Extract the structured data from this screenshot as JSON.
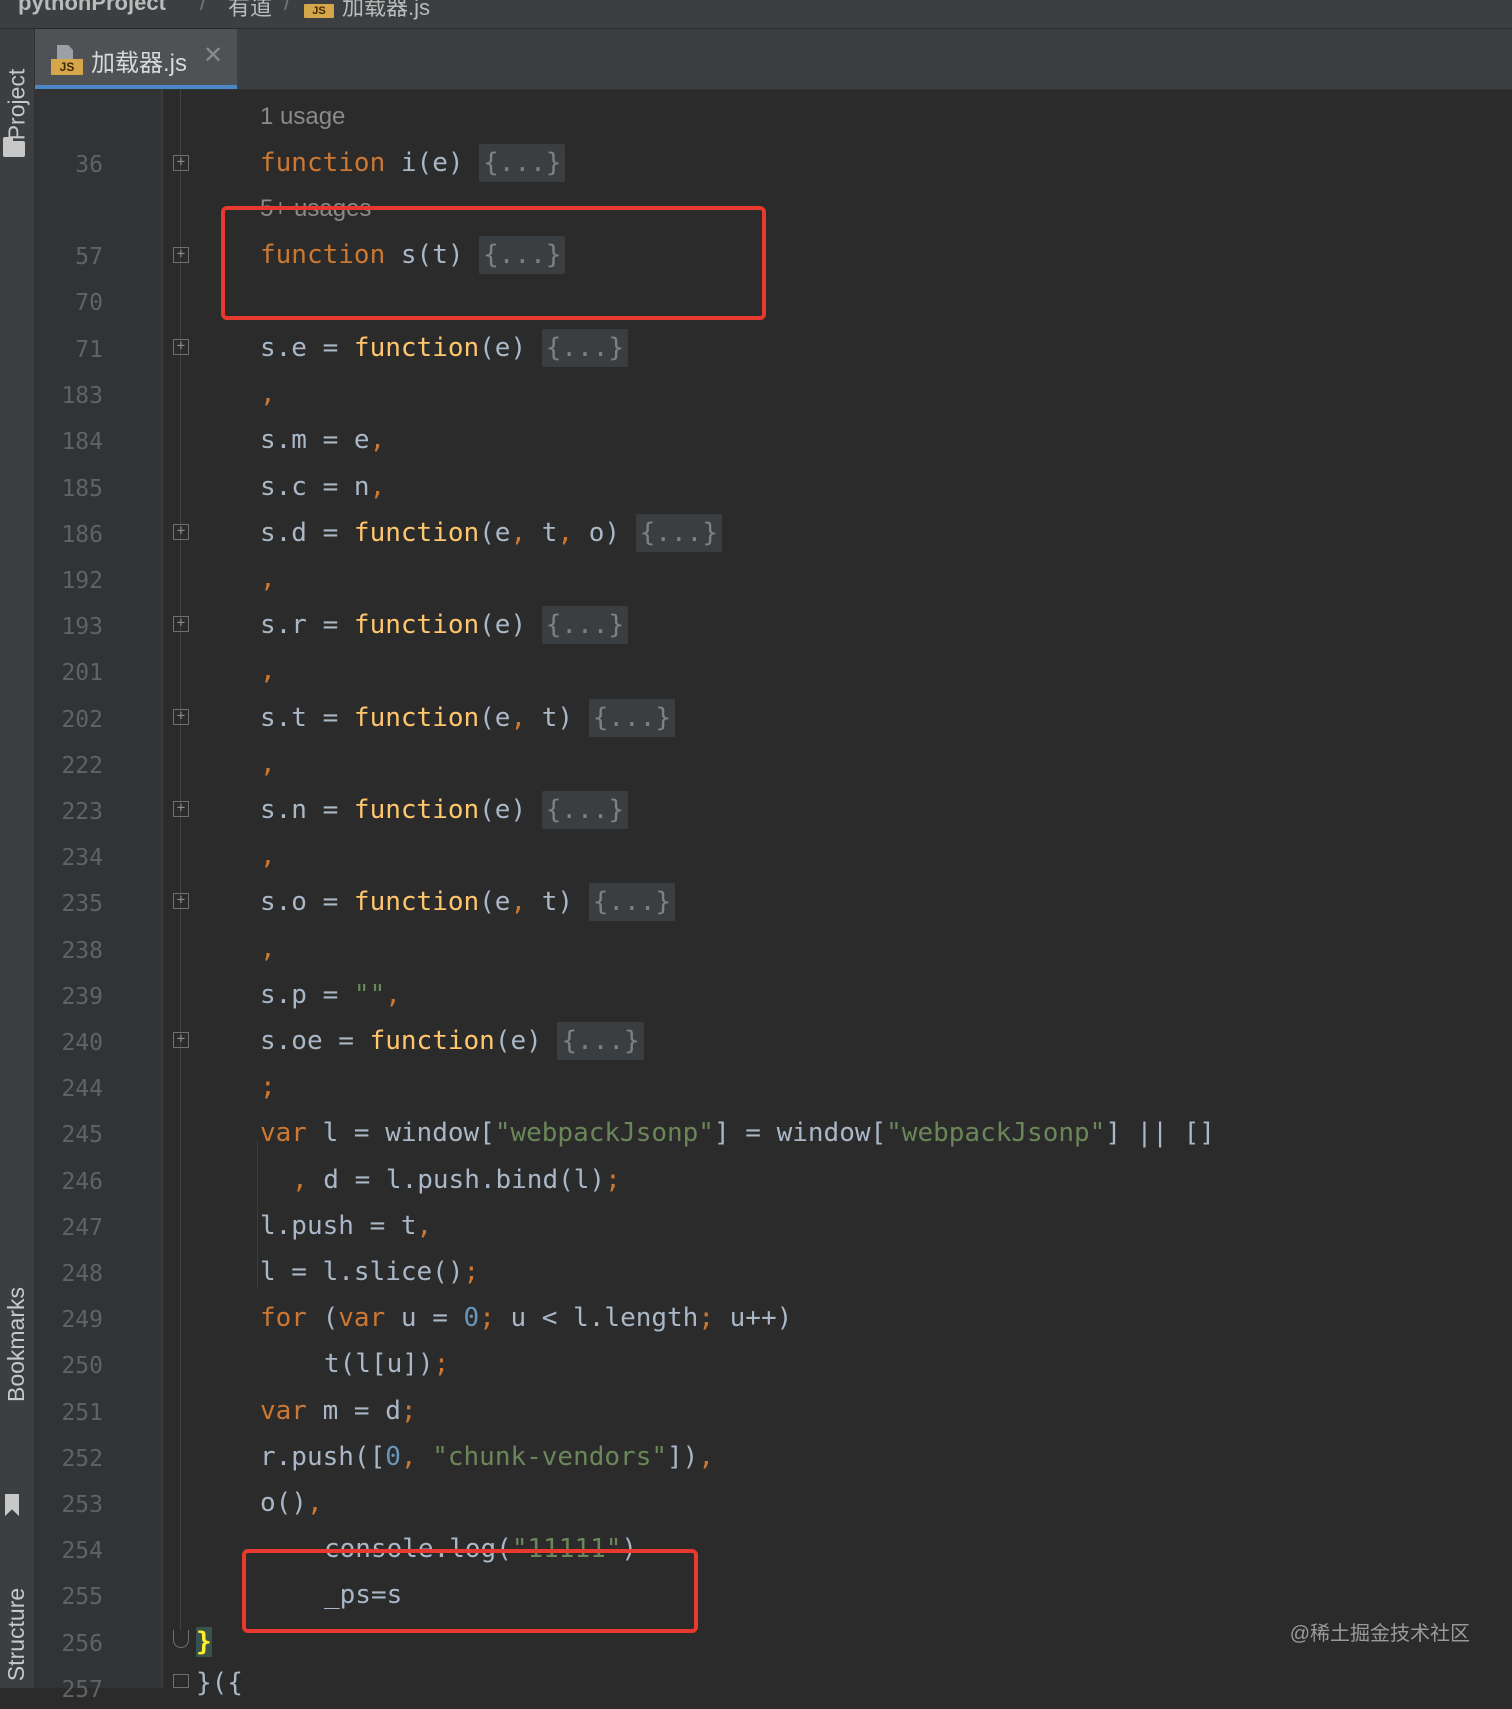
{
  "breadcrumb": {
    "project": "pythonProject",
    "separator": "/",
    "folder": "有道",
    "file_badge": "JS",
    "file": "加载器.js"
  },
  "toolstrip": {
    "project_label": "Project",
    "bookmarks_label": "Bookmarks",
    "structure_label": "Structure"
  },
  "tab": {
    "badge": "JS",
    "label": "加载器.js",
    "close": "✕"
  },
  "editor": {
    "usage_hint_1": "1 usage",
    "usage_hint_2": "5+ usages",
    "line_numbers": [
      "36",
      "57",
      "70",
      "71",
      "183",
      "184",
      "185",
      "186",
      "192",
      "193",
      "201",
      "202",
      "222",
      "223",
      "234",
      "235",
      "238",
      "239",
      "240",
      "244",
      "245",
      "246",
      "247",
      "248",
      "249",
      "250",
      "251",
      "252",
      "253",
      "254",
      "255",
      "256",
      "257"
    ],
    "folded_placeholder": "{...}",
    "lines": {
      "l36_kw": "function",
      "l36_name": " i(e) ",
      "l57_kw": "function",
      "l57_name": " s(t) ",
      "l71_pre": "s.e = ",
      "l71_kw": "function",
      "l71_args": "(e) ",
      "comma": ",",
      "l184_pre": "s.m = e",
      "l185_pre": "s.c = n",
      "l186_pre": "s.d = ",
      "l186_kw": "function",
      "l186_a1": "(e",
      "l186_a2": " t",
      "l186_a3": " o) ",
      "l193_pre": "s.r = ",
      "l193_kw": "function",
      "l193_args": "(e) ",
      "l202_pre": "s.t = ",
      "l202_kw": "function",
      "l202_a1": "(e",
      "l202_a2": " t) ",
      "l223_pre": "s.n = ",
      "l223_kw": "function",
      "l223_args": "(e) ",
      "l235_pre": "s.o = ",
      "l235_kw": "function",
      "l235_a1": "(e",
      "l235_a2": " t) ",
      "l239_pre": "s.p = ",
      "l239_str": "\"\"",
      "l240_pre": "s.oe = ",
      "l240_kw": "function",
      "l240_args": "(e) ",
      "semicolon": ";",
      "l245_kw": "var",
      "l245_a": " l = window[",
      "l245_s1": "\"webpackJsonp\"",
      "l245_b": "] = window[",
      "l245_s2": "\"webpackJsonp\"",
      "l245_c": "] || []",
      "l246_a": " d = l.push.bind(l)",
      "l247_a": "l.push = t",
      "l248_a": "l = l.slice()",
      "l249_kw1": "for",
      "l249_a": " (",
      "l249_kw2": "var",
      "l249_b": " u = ",
      "l249_n": "0",
      "l249_c": " u < l.length",
      "l249_d": " u++)",
      "l250_a": "t(l[u])",
      "l251_kw": "var",
      "l251_a": " m = d",
      "l252_a": "r.push([",
      "l252_n": "0",
      "l252_s": " \"chunk-vendors\"",
      "l252_b": "])",
      "l253_a": "o()",
      "l254_a": "console.log(",
      "l254_s": "\"11111\"",
      "l254_b": ")",
      "l255_a": "_ps=s",
      "l256_brace": "}",
      "l257_a": "}({"
    }
  },
  "watermark": "@稀土掘金技术社区",
  "colors": {
    "background": "#2b2b2b",
    "keyword": "#cc7832",
    "function_name": "#ffc66d",
    "string": "#6a8759",
    "number": "#6897bb",
    "annotation_box": "#e8392e"
  }
}
